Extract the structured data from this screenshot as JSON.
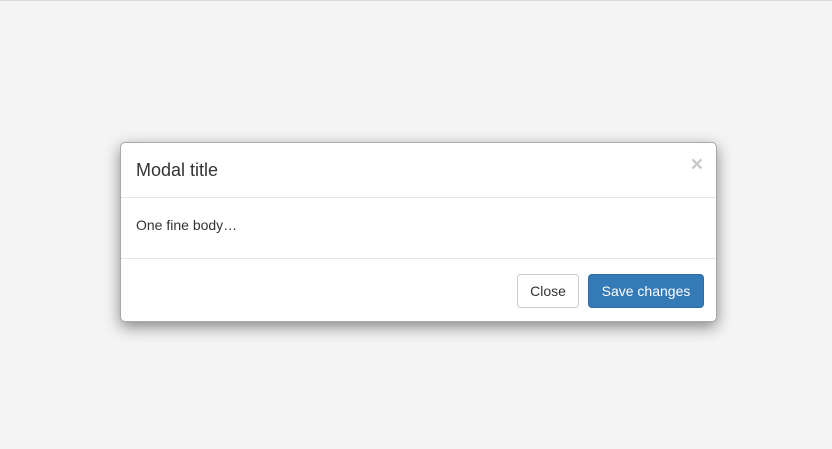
{
  "modal": {
    "title": "Modal title",
    "close_symbol": "×",
    "body_text": "One fine body…",
    "footer": {
      "close_label": "Close",
      "save_label": "Save changes"
    }
  },
  "colors": {
    "backdrop": "#f4f4f4",
    "primary": "#337ab7",
    "text": "#333333"
  }
}
